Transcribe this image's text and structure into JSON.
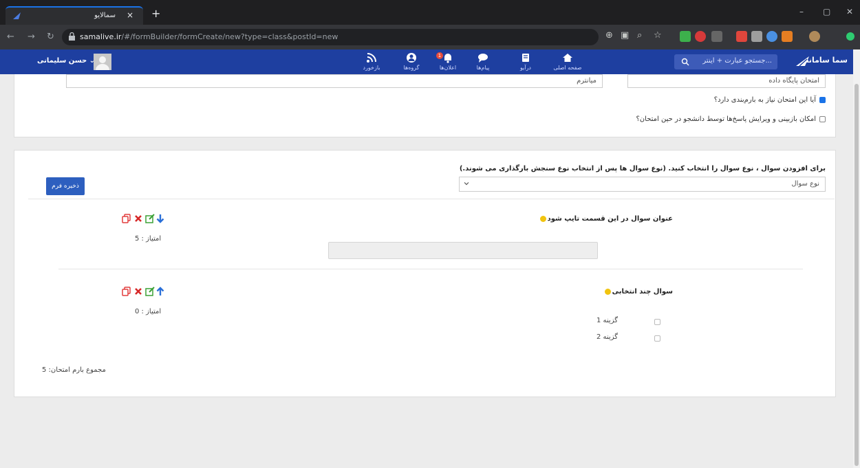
{
  "browser": {
    "tab_title": "سمالایو",
    "url_host": "samalive.ir",
    "url_path": "/#/formBuilder/formCreate/new?type=class&postId=new"
  },
  "header": {
    "brand": "سما سامانه",
    "search_placeholder": "جستجو عبارت + اینتر...",
    "user_name": "حسن سلیمانی",
    "nav": [
      {
        "label": "بازخورد",
        "icon": "rss-icon"
      },
      {
        "label": "گروه‌ها",
        "icon": "groups-icon"
      },
      {
        "label": "اعلان‌ها",
        "icon": "notifications-icon",
        "badge": "1"
      },
      {
        "label": "پیام‌ها",
        "icon": "chat-icon"
      },
      {
        "label": "درآیو",
        "icon": "book-icon"
      },
      {
        "label": "صفحه اصلی",
        "icon": "home-icon"
      }
    ]
  },
  "settings": {
    "exam_name_value": "امتحان پایگاه داده",
    "exam_type_value": "میانترم",
    "grading_label": "آیا این امتحان نیاز به بارم‌بندی دارد؟",
    "grading_checked": true,
    "review_label": "امکان بازبینی و ویرایش پاسخ‌ها توسط دانشجو در حین امتحان؟",
    "review_checked": false
  },
  "builder": {
    "instruction": "برای افزودن سوال ، نوع سوال را انتخاب کنید. (نوع سوال ها پس از انتخاب نوع سنجش بارگذاری می شوند.)",
    "question_type_placeholder": "نوع سوال",
    "save_label": "ذخیره فرم",
    "questions": [
      {
        "title": "عنوان سوال در این قسمت تایپ شود",
        "score": "امتیاز : 5"
      },
      {
        "title": "سوال چند انتخابی",
        "score": "امتیاز : 0",
        "options": [
          "گزینه 1",
          "گزینه 2"
        ]
      }
    ],
    "total": "مجموع بارم امتحان: 5"
  },
  "colors": {
    "appbar": "#1e3fa0",
    "primary_button": "#2d5fbf",
    "delete": "#d62828",
    "edit": "#3aa135",
    "move": "#2a6fd8",
    "copy": "#e23d3d"
  }
}
